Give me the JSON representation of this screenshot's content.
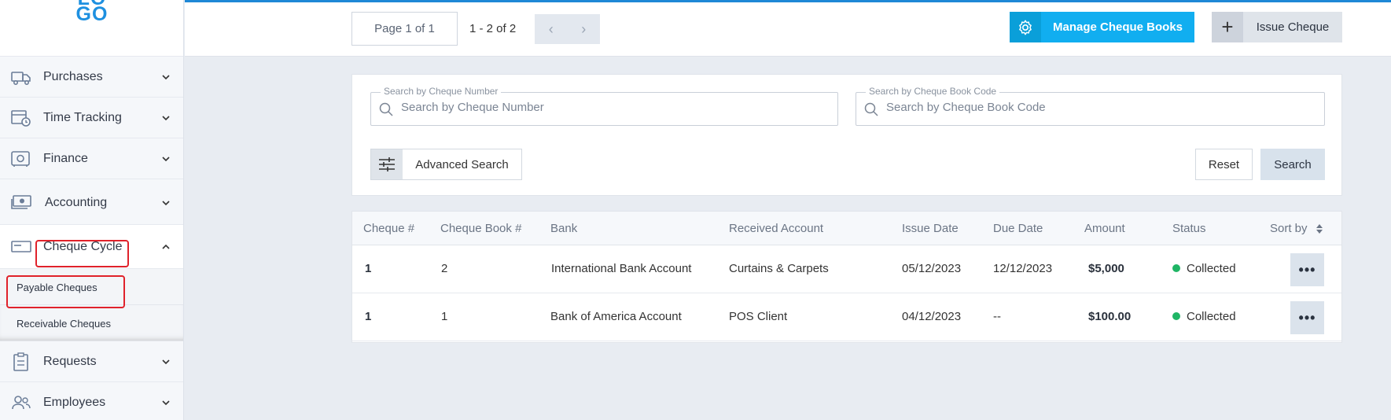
{
  "logo": {
    "line1": "LO",
    "line2": "GO"
  },
  "sidebar": {
    "items": [
      {
        "label": "Purchases"
      },
      {
        "label": "Time Tracking"
      },
      {
        "label": "Finance"
      },
      {
        "label": "Accounting"
      },
      {
        "label": "Cheque Cycle"
      },
      {
        "label": "Requests"
      },
      {
        "label": "Employees"
      }
    ],
    "sub_items": [
      {
        "label": "Payable Cheques"
      },
      {
        "label": "Receivable Cheques"
      }
    ]
  },
  "toolbar": {
    "page_label": "Page 1 of 1",
    "range_label": "1 - 2 of 2",
    "prev": "‹",
    "next": "›",
    "manage_label": "Manage Cheque Books",
    "issue_label": "Issue Cheque",
    "issue_icon": "+"
  },
  "search": {
    "cheque_number_legend": "Search by Cheque Number",
    "cheque_number_placeholder": "Search by Cheque Number",
    "cheque_book_legend": "Search by Cheque Book Code",
    "cheque_book_placeholder": "Search by Cheque Book Code",
    "advanced_label": "Advanced Search",
    "reset_label": "Reset",
    "search_label": "Search"
  },
  "table": {
    "columns": [
      "Cheque #",
      "Cheque Book #",
      "Bank",
      "Received Account",
      "Issue Date",
      "Due Date",
      "Amount",
      "Status",
      "Sort by"
    ],
    "rows": [
      {
        "cheque": "1",
        "book": "2",
        "bank": "International Bank Account",
        "account": "Curtains & Carpets",
        "issue_date": "05/12/2023",
        "due_date": "12/12/2023",
        "amount": "$5,000",
        "status": "Collected",
        "more": "•••"
      },
      {
        "cheque": "1",
        "book": "1",
        "bank": "Bank of America Account",
        "account": "POS Client",
        "issue_date": "04/12/2023",
        "due_date": "--",
        "amount": "$100.00",
        "status": "Collected",
        "more": "•••"
      }
    ]
  },
  "colors": {
    "accent": "#11aef0",
    "status_collected": "#1fb565",
    "highlight": "#e0222b",
    "link_blue": "#1e88d6"
  }
}
